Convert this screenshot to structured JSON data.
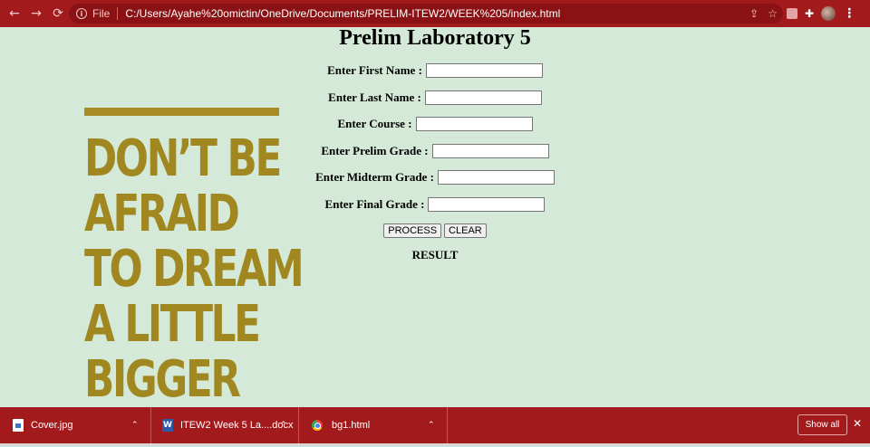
{
  "browser": {
    "file_label": "File",
    "url": "C:/Users/Ayahe%20omictin/OneDrive/Documents/PRELIM-ITEW2/WEEK%205/index.html",
    "back_glyph": "←",
    "forward_glyph": "→",
    "reload_glyph": "⟳",
    "share_glyph": "⇪",
    "star_glyph": "☆",
    "extensions_glyph": "✚",
    "menu_glyph": "⋮",
    "info_glyph": "i"
  },
  "poster": {
    "lines": [
      "DON’T BE",
      "AFRAID",
      "TO DREAM",
      "A LITTLE",
      "BIGGER"
    ],
    "color": "#a1871f"
  },
  "form": {
    "title": "Prelim Laboratory 5",
    "fields": [
      {
        "label": "Enter First Name :",
        "value": ""
      },
      {
        "label": "Enter Last Name :",
        "value": ""
      },
      {
        "label": "Enter Course :",
        "value": ""
      },
      {
        "label": "Enter Prelim Grade :",
        "value": ""
      },
      {
        "label": "Enter Midterm Grade :",
        "value": ""
      },
      {
        "label": "Enter Final Grade :",
        "value": ""
      }
    ],
    "process_label": "PROCESS",
    "clear_label": "CLEAR",
    "result_label": "RESULT"
  },
  "downloads": {
    "items": [
      {
        "name": "Cover.jpg",
        "icon": "image-file-icon"
      },
      {
        "name": "ITEW2 Week 5 La....docx",
        "icon": "word-doc-icon"
      },
      {
        "name": "bg1.html",
        "icon": "chrome-html-icon"
      }
    ],
    "caret_glyph": "⌃",
    "show_all_label": "Show all",
    "close_glyph": "✕"
  },
  "colors": {
    "chrome": "#a31a1c",
    "page_background": "#d4e9d8",
    "poster_gold": "#a1871f"
  }
}
